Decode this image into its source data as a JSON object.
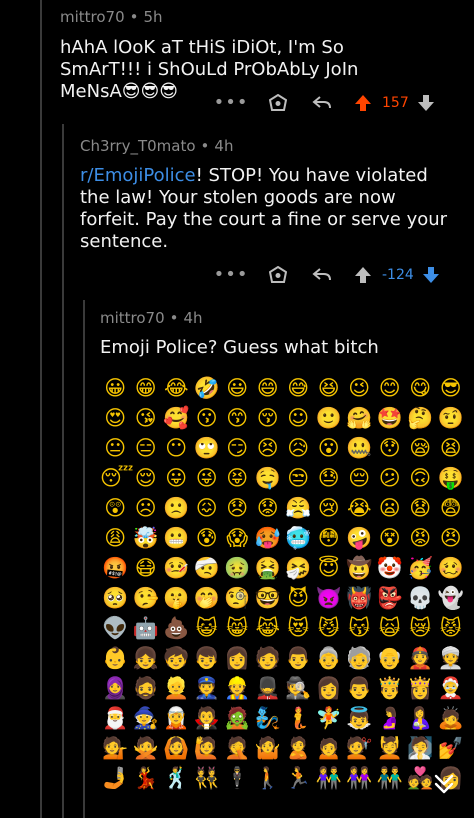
{
  "comment1": {
    "username": "mittro70",
    "age": "5h",
    "text": "hAhA lOoK aT tHiS iDiOt, I'm So SmArT!!! i ShOuLd PrObAbLy JoIn MeNsA😎😎😎",
    "score": "157",
    "vote_color": "#ff4500"
  },
  "comment2": {
    "username": "Ch3rry_T0mato",
    "age": "4h",
    "link_text": "r/EmojiPolice",
    "text": "! STOP! You have violated the law! Your stolen goods are now forfeit. Pay the court a fine or serve your sentence.",
    "score": "-124",
    "vote_color": "#3d8ee6"
  },
  "comment3": {
    "username": "mittro70",
    "age": "4h",
    "text": "Emoji Police? Guess what bitch",
    "emojis": [
      "😀",
      "😁",
      "😂",
      "🤣",
      "😃",
      "😄",
      "😅",
      "😆",
      "😉",
      "😊",
      "😋",
      "😎",
      "😍",
      "😘",
      "🥰",
      "😗",
      "😙",
      "😚",
      "☺",
      "🙂",
      "🤗",
      "🤩",
      "🤔",
      "🤨",
      "😐",
      "😑",
      "😶",
      "🙄",
      "😏",
      "😣",
      "😥",
      "😮",
      "🤐",
      "😯",
      "😪",
      "😫",
      "😴",
      "😌",
      "😛",
      "😜",
      "😝",
      "🤤",
      "😒",
      "😓",
      "😔",
      "😕",
      "🙃",
      "🤑",
      "😲",
      "☹",
      "🙁",
      "😖",
      "😞",
      "😟",
      "😤",
      "😢",
      "😭",
      "😦",
      "😧",
      "😨",
      "😩",
      "🤯",
      "😬",
      "😰",
      "😱",
      "🥵",
      "🥶",
      "😳",
      "🤪",
      "😵",
      "😡",
      "😠",
      "🤬",
      "😷",
      "🤒",
      "🤕",
      "🤢",
      "🤮",
      "🤧",
      "😇",
      "🤠",
      "🤡",
      "🥳",
      "🥴",
      "🥺",
      "🤥",
      "🤫",
      "🤭",
      "🧐",
      "🤓",
      "😈",
      "👿",
      "👹",
      "👺",
      "💀",
      "👻",
      "👽",
      "🤖",
      "💩",
      "😺",
      "😸",
      "😹",
      "😻",
      "😼",
      "😽",
      "🙀",
      "😿",
      "😾",
      "👶",
      "👧",
      "🧒",
      "👦",
      "👩",
      "🧑",
      "👨",
      "👵",
      "🧓",
      "👴",
      "👲",
      "👳",
      "🧕",
      "🧔",
      "👱",
      "👮",
      "👷",
      "💂",
      "🕵",
      "👩",
      "👨",
      "🤴",
      "👸",
      "🤶",
      "🎅",
      "🧙",
      "🧝",
      "🧛",
      "🧟",
      "🧞",
      "🧜",
      "🧚",
      "👼",
      "🤰",
      "🤱",
      "🙇",
      "💁",
      "🙅",
      "🙆",
      "🙋",
      "🤦",
      "🤷",
      "🙎",
      "🙍",
      "💇",
      "💆",
      "🧖",
      "💅",
      "🤳",
      "💃",
      "🕺",
      "👯",
      "🕴",
      "🚶",
      "🏃",
      "👫",
      "👭",
      "👬",
      "💑",
      "👩",
      "👨",
      "💏",
      "👪",
      "👚",
      "👕",
      "👖",
      "👔",
      "👗",
      "👙",
      "👘",
      "👠",
      "👡",
      "👢",
      "👞",
      "👟",
      "🥾",
      "🥿",
      "🧦",
      "🧤",
      "🧣",
      "🎩",
      "🧢",
      "👒",
      "🎓",
      "⛑",
      "👑",
      "👝",
      "👛",
      "👜",
      "💼",
      "🎒",
      "👓",
      "🕶",
      "🥽",
      "🌂",
      "☂",
      "🧳",
      "💍",
      "💄",
      "💋",
      "👄",
      "👅",
      "👂",
      "👃",
      "👣",
      "👁",
      "👀",
      "🧠",
      "🗣",
      "👤",
      "👥",
      "🦷",
      "🦴",
      "👩",
      "👨",
      "🧑",
      "👩",
      "👨",
      "👩"
    ],
    "collapse_icon": "double-chevron-down-icon"
  }
}
